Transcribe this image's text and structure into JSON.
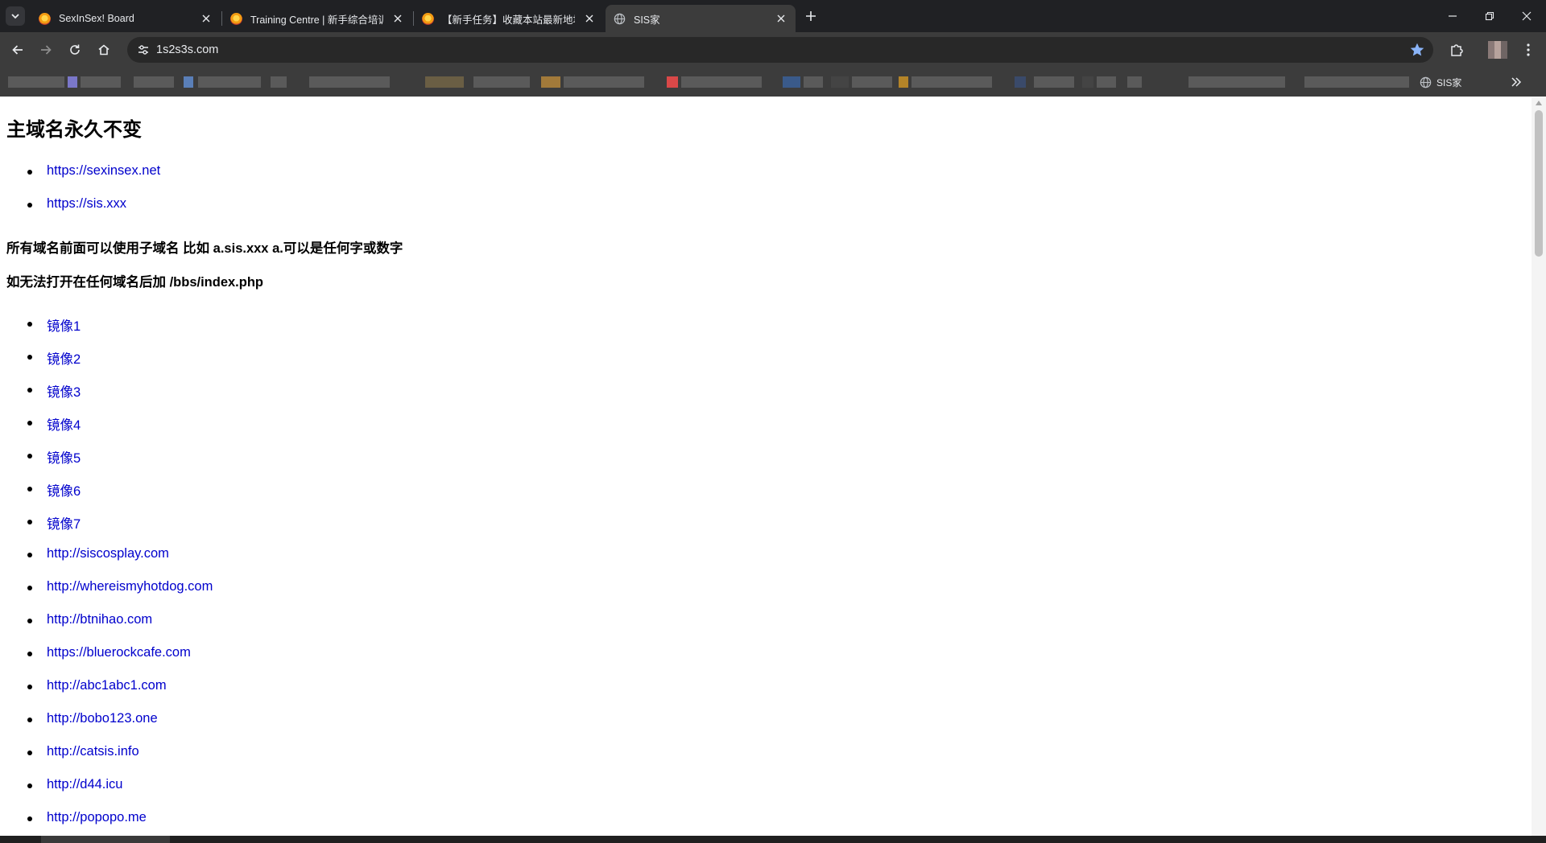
{
  "browser": {
    "tabs": [
      {
        "title": "SexInSex! Board",
        "favicon": "forum-flame-icon",
        "active": false
      },
      {
        "title": "Training Centre | 新手综合培训",
        "favicon": "forum-flame-icon",
        "active": false
      },
      {
        "title": "【新手任务】收藏本站最新地址",
        "favicon": "forum-flame-icon",
        "active": false
      },
      {
        "title": "SIS家",
        "favicon": "globe-icon",
        "active": true
      }
    ],
    "url": "1s2s3s.com",
    "bookmark_folder": "SIS家",
    "colors": {
      "tabstrip": "#202124",
      "toolbar": "#3c3c3c",
      "star": "#8ab4f8"
    }
  },
  "page": {
    "heading": "主域名永久不变",
    "main_links": [
      "https://sexinsex.net",
      "https://sis.xxx"
    ],
    "note1": "所有域名前面可以使用子域名 比如 a.sis.xxx   a.可以是任何字或数字",
    "note2": "如无法打开在任何域名后加 /bbs/index.php",
    "mirrors": [
      "镜像1",
      "镜像2",
      "镜像3",
      "镜像4",
      "镜像5",
      "镜像6",
      "镜像7",
      "http://siscosplay.com",
      "http://whereismyhotdog.com",
      "http://btnihao.com",
      "https://bluerockcafe.com",
      "http://abc1abc1.com",
      "http://bobo123.one",
      "http://catsis.info",
      "http://d44.icu",
      "http://popopo.me"
    ],
    "link_color": "#0000cc"
  }
}
